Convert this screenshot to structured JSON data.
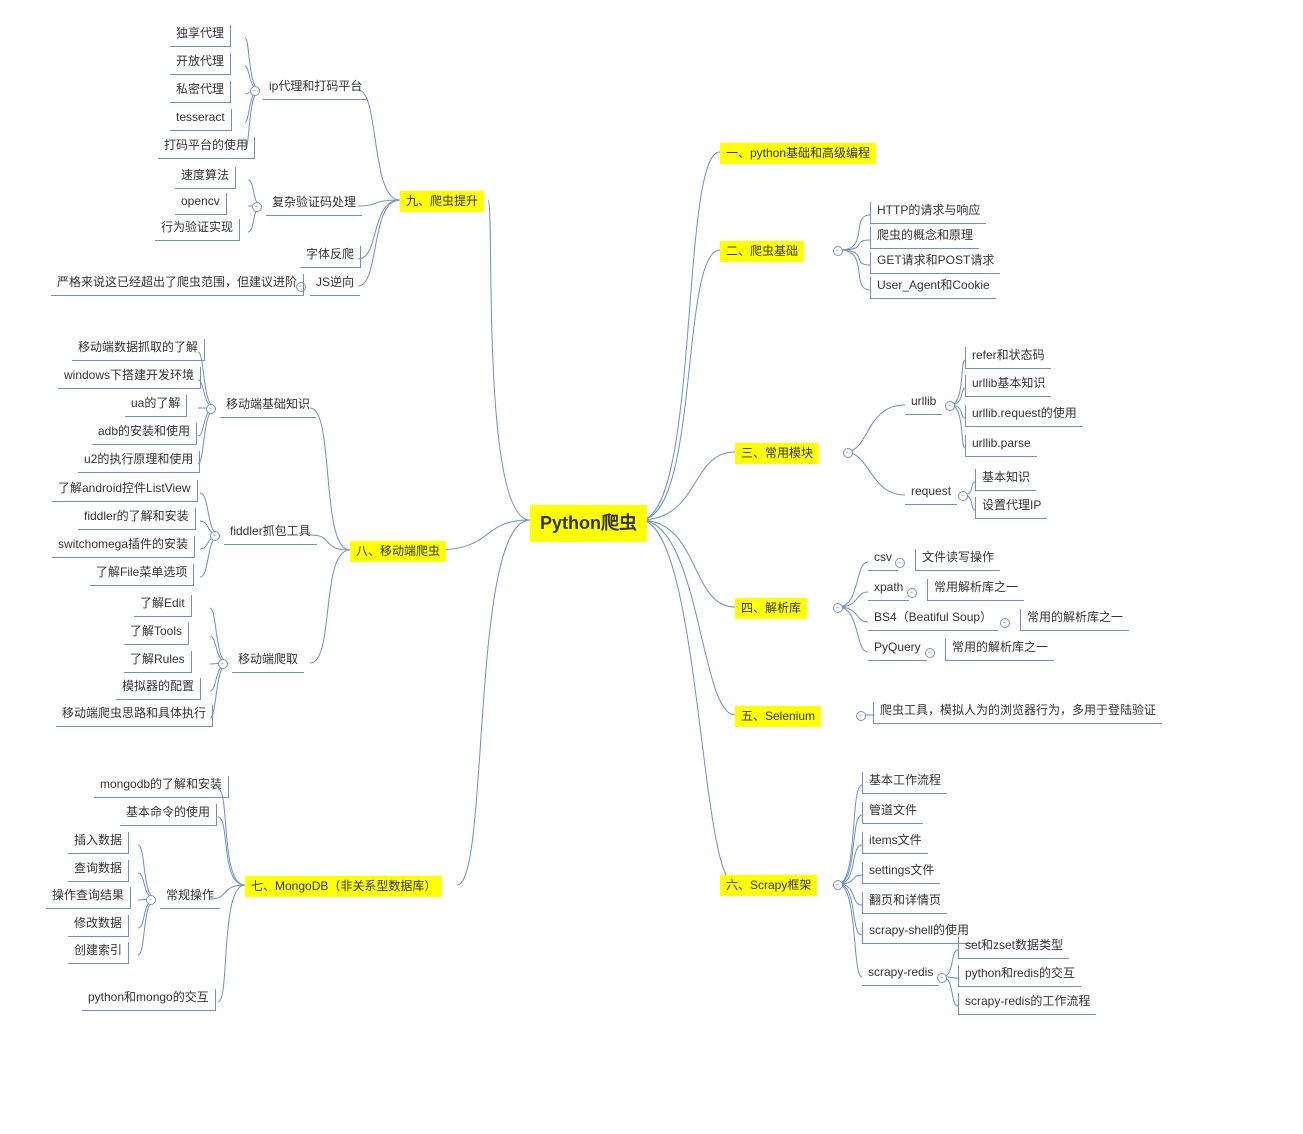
{
  "root": "Python爬虫",
  "r1": "一、python基础和高级编程",
  "r2": {
    "title": "二、爬虫基础",
    "items": [
      "HTTP的请求与响应",
      "爬虫的概念和原理",
      "GET请求和POST请求",
      "User_Agent和Cookie"
    ]
  },
  "r3": {
    "title": "三、常用模块",
    "urllib": {
      "title": "urllib",
      "items": [
        "refer和状态码",
        "urllib基本知识",
        "urllib.request的使用",
        "urllib.parse"
      ]
    },
    "request": {
      "title": "request",
      "items": [
        "基本知识",
        "设置代理IP"
      ]
    }
  },
  "r4": {
    "title": "四、解析库",
    "rows": [
      {
        "k": "csv",
        "v": "文件读写操作"
      },
      {
        "k": "xpath",
        "v": "常用解析库之一"
      },
      {
        "k": "BS4（Beatiful Soup）",
        "v": "常用的解析库之一"
      },
      {
        "k": "PyQuery",
        "v": "常用的解析库之一"
      }
    ]
  },
  "r5": {
    "title": "五、Selenium",
    "note": "爬虫工具，模拟人为的浏览器行为，多用于登陆验证"
  },
  "r6": {
    "title": "六、Scrapy框架",
    "main": [
      "基本工作流程",
      "管道文件",
      "items文件",
      "settings文件",
      "翻页和详情页",
      "scrapy-shell的使用"
    ],
    "redis": {
      "title": "scrapy-redis",
      "items": [
        "set和zset数据类型",
        "python和redis的交互",
        "scrapy-redis的工作流程"
      ]
    }
  },
  "l7": {
    "title": "七、MongoDB（非关系型数据库）",
    "top": [
      "mongodb的了解和安装",
      "基本命令的使用"
    ],
    "ops": {
      "title": "常规操作",
      "items": [
        "插入数据",
        "查询数据",
        "操作查询结果",
        "修改数据",
        "创建索引"
      ]
    },
    "bottom": [
      "python和mongo的交互"
    ]
  },
  "l8": {
    "title": "八、移动端爬虫",
    "g1": {
      "title": "移动端基础知识",
      "items": [
        "移动端数据抓取的了解",
        "windows下搭建开发环境",
        "ua的了解",
        "adb的安装和使用",
        "u2的执行原理和使用"
      ]
    },
    "g2": {
      "title": "fiddler抓包工具",
      "items": [
        "了解android控件ListView",
        "fiddler的了解和安装",
        "switchomega插件的安装",
        "了解File菜单选项"
      ]
    },
    "g3": {
      "title": "移动端爬取",
      "items": [
        "了解Edit",
        "了解Tools",
        "了解Rules",
        "模拟器的配置",
        "移动端爬虫思路和具体执行"
      ]
    }
  },
  "l9": {
    "title": "九、爬虫提升",
    "g1": {
      "title": "ip代理和打码平台",
      "items": [
        "独享代理",
        "开放代理",
        "私密代理",
        "tesseract",
        "打码平台的使用"
      ]
    },
    "g2": {
      "title": "复杂验证码处理",
      "items": [
        "速度算法",
        "opencv",
        "行为验证实现"
      ]
    },
    "g3": {
      "label": "字体反爬"
    },
    "g4": {
      "label": "JS逆向",
      "note": "严格来说这已经超出了爬虫范围，但建议进阶"
    }
  }
}
